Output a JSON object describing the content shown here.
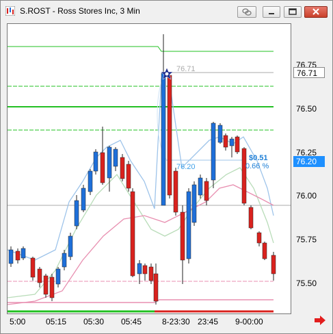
{
  "window": {
    "title": "S.ROST - Ross Stores Inc, 3 Min"
  },
  "price_axis": {
    "ticks": [
      "76.75",
      "76.50",
      "76.25",
      "76.00",
      "75.75",
      "75.50"
    ],
    "current_price": "76.71",
    "current_price_color": "#000000",
    "current_price_bg": "#ffffff",
    "crosshair_price": "76.20",
    "crosshair_color": "#ffffff",
    "crosshair_bg": "#1e90ff"
  },
  "time_axis": {
    "labels": [
      "5:00",
      "05:15",
      "05:30",
      "05:45",
      "8-23:30",
      "23:45",
      "9-00:00"
    ]
  },
  "annotations": {
    "high_label": "76.71",
    "measure_price": "76.20",
    "measure_change": "$0.51",
    "measure_percent": "0.66 %"
  },
  "colors": {
    "up": "#1e6fd9",
    "down": "#d9221e",
    "green": "#22c022",
    "pink": "#e88fb0",
    "blue_band": "#9ec4ea",
    "green_band": "#b8dcb8"
  },
  "icons": [
    "app-icon",
    "link-icon",
    "minimize-icon",
    "restore-icon",
    "close-icon",
    "scroll-right-icon",
    "marker-star-icon"
  ]
}
